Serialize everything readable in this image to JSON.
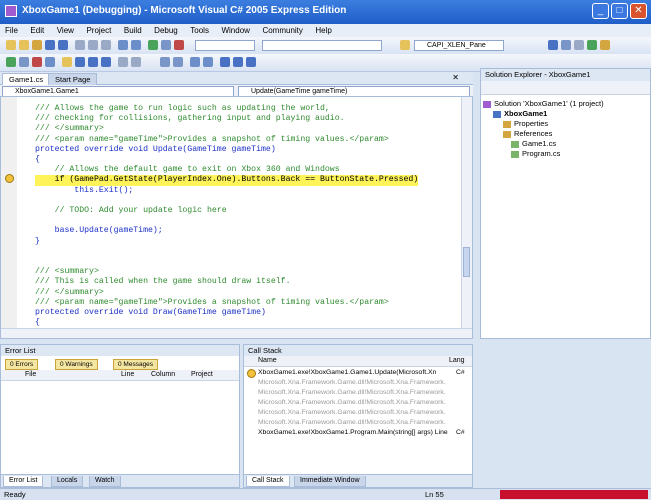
{
  "window": {
    "title": "XboxGame1 (Debugging) - Microsoft Visual C# 2005 Express Edition",
    "controls": {
      "minimize": "_",
      "maximize": "□",
      "close": "✕"
    }
  },
  "menu": [
    "File",
    "Edit",
    "View",
    "Project",
    "Build",
    "Debug",
    "Tools",
    "Window",
    "Community",
    "Help"
  ],
  "toolbar": {
    "config_combo": "CAPI_XLEN_Pane"
  },
  "editor": {
    "tabs": [
      "Game1.cs",
      "Start Page"
    ],
    "class_dropdown": "XboxGame1.Game1",
    "member_dropdown": "Update(GameTime gameTime)",
    "code_lines": [
      {
        "t": "/// Allows the game to run logic such as updating the world,",
        "k": "comment"
      },
      {
        "t": "/// checking for collisions, gathering input and playing audio.",
        "k": "comment"
      },
      {
        "t": "/// </summary>",
        "k": "comment"
      },
      {
        "t": "/// <param name=\"gameTime\">Provides a snapshot of timing values.</param>",
        "k": "comment"
      },
      {
        "t": "protected override void Update(GameTime gameTime)",
        "k": "code"
      },
      {
        "t": "{",
        "k": "code"
      },
      {
        "t": "    // Allows the default game to exit on Xbox 360 and Windows",
        "k": "comment"
      },
      {
        "t": "    if (GamePad.GetState(PlayerIndex.One).Buttons.Back == ButtonState.Pressed)",
        "k": "hl"
      },
      {
        "t": "        this.Exit();",
        "k": "code"
      },
      {
        "t": "",
        "k": "code"
      },
      {
        "t": "    // TODO: Add your update logic here",
        "k": "comment"
      },
      {
        "t": "",
        "k": "code"
      },
      {
        "t": "    base.Update(gameTime);",
        "k": "code"
      },
      {
        "t": "}",
        "k": "code"
      },
      {
        "t": "",
        "k": "code"
      },
      {
        "t": "",
        "k": "code"
      },
      {
        "t": "/// <summary>",
        "k": "comment"
      },
      {
        "t": "/// This is called when the game should draw itself.",
        "k": "comment"
      },
      {
        "t": "/// </summary>",
        "k": "comment"
      },
      {
        "t": "/// <param name=\"gameTime\">Provides a snapshot of timing values.</param>",
        "k": "comment"
      },
      {
        "t": "protected override void Draw(GameTime gameTime)",
        "k": "code"
      },
      {
        "t": "{",
        "k": "code"
      }
    ]
  },
  "solution_explorer": {
    "title": "Solution Explorer - XboxGame1",
    "items": [
      "Solution 'XboxGame1' (1 project)",
      "XboxGame1",
      "Properties",
      "References",
      "Game1.cs",
      "Program.cs"
    ]
  },
  "error_list": {
    "title": "Error List",
    "filters": [
      "0 Errors",
      "0 Warnings",
      "0 Messages"
    ],
    "columns": [
      "File",
      "Line",
      "Column",
      "Project"
    ],
    "tabs": [
      "Error List",
      "Locals",
      "Watch"
    ]
  },
  "call_stack": {
    "title": "Call Stack",
    "columns": [
      "Name",
      "Lang"
    ],
    "rows": [
      {
        "name": "XboxGame1.exe!XboxGame1.Game1.Update(Microsoft.Xn",
        "lang": "C#",
        "grey": false
      },
      {
        "name": "Microsoft.Xna.Framework.Game.dll!Microsoft.Xna.Framework.",
        "lang": "",
        "grey": true
      },
      {
        "name": "Microsoft.Xna.Framework.Game.dll!Microsoft.Xna.Framework.",
        "lang": "",
        "grey": true
      },
      {
        "name": "Microsoft.Xna.Framework.Game.dll!Microsoft.Xna.Framework.",
        "lang": "",
        "grey": true
      },
      {
        "name": "Microsoft.Xna.Framework.Game.dll!Microsoft.Xna.Framework.",
        "lang": "",
        "grey": true
      },
      {
        "name": "Microsoft.Xna.Framework.Game.dll!Microsoft.Xna.Framework.",
        "lang": "",
        "grey": true
      },
      {
        "name": "XboxGame1.exe!XboxGame1.Program.Main(string[] args) Line",
        "lang": "C#",
        "grey": false
      }
    ],
    "tabs": [
      "Call Stack",
      "Immediate Window"
    ]
  },
  "status": {
    "ready": "Ready",
    "position": "Ln 55"
  }
}
